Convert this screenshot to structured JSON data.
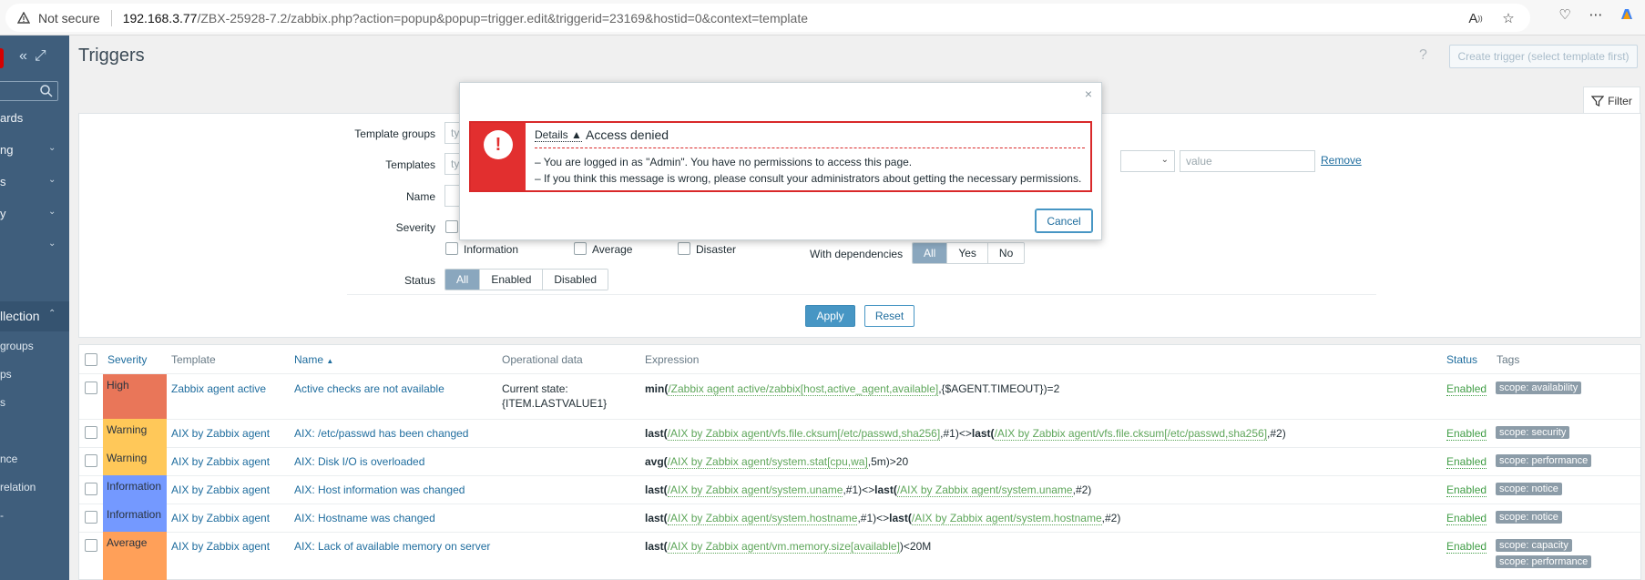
{
  "browser": {
    "not_secure": "Not secure",
    "url_host": "192.168.3.77",
    "url_rest": "/ZBX-25928-7.2/zabbix.php?action=popup&popup=trigger.edit&triggerid=23169&hostid=0&context=template"
  },
  "sidebar": {
    "items": [
      {
        "label": "ards",
        "chevron": false
      },
      {
        "label": "ng",
        "chevron": true
      },
      {
        "label": "s",
        "chevron": true
      },
      {
        "label": "y",
        "chevron": true
      },
      {
        "label": "",
        "chevron": true
      },
      {
        "label": "llection",
        "chevron": true
      },
      {
        "label": "",
        "chevron": true
      }
    ],
    "subitems": [
      "groups",
      "ps",
      "s",
      "nce",
      "relation",
      "-"
    ]
  },
  "page": {
    "title": "Triggers",
    "help": "?",
    "create_button": "Create trigger (select template first)"
  },
  "filter": {
    "tab_label": "Filter",
    "template_groups_label": "Template groups",
    "templates_label": "Templates",
    "name_label": "Name",
    "severity_label": "Severity",
    "status_label": "Status",
    "input_placeholder_short": "ty",
    "value_placeholder": "value",
    "remove": "Remove",
    "severity_options": [
      "Information",
      "Average",
      "Disaster"
    ],
    "status_options": [
      "All",
      "Enabled",
      "Disabled"
    ],
    "with_dependencies_label": "With dependencies",
    "dependency_options": [
      "All",
      "Yes",
      "No"
    ],
    "apply": "Apply",
    "reset": "Reset"
  },
  "table": {
    "headers": {
      "severity": "Severity",
      "template": "Template",
      "name": "Name",
      "name_sort": "▲",
      "operational_data": "Operational data",
      "expression": "Expression",
      "status": "Status",
      "tags": "Tags"
    },
    "rows": [
      {
        "severity": "High",
        "severity_color": "#e97659",
        "template": "Zabbix agent active",
        "name": "Active checks are not available",
        "opdata1": "Current state:",
        "opdata2": "{ITEM.LASTVALUE1}",
        "fn1": "min(",
        "key1": "/Zabbix agent active/zabbix[host,active_agent,available]",
        "mid": ",{$AGENT.TIMEOUT})=2",
        "fn2": "",
        "key2": "",
        "end": "",
        "status": "Enabled",
        "tags": [
          "scope: availability"
        ]
      },
      {
        "severity": "Warning",
        "severity_color": "#ffc859",
        "template": "AIX by Zabbix agent",
        "name": "AIX: /etc/passwd has been changed",
        "opdata1": "",
        "opdata2": "",
        "fn1": "last(",
        "key1": "/AIX by Zabbix agent/vfs.file.cksum[/etc/passwd,sha256]",
        "mid": ",#1)<>",
        "fn2": "last(",
        "key2": "/AIX by Zabbix agent/vfs.file.cksum[/etc/passwd,sha256]",
        "end": ",#2)",
        "status": "Enabled",
        "tags": [
          "scope: security"
        ]
      },
      {
        "severity": "Warning",
        "severity_color": "#ffc859",
        "template": "AIX by Zabbix agent",
        "name": "AIX: Disk I/O is overloaded",
        "opdata1": "",
        "opdata2": "",
        "fn1": "avg(",
        "key1": "/AIX by Zabbix agent/system.stat[cpu,wa]",
        "mid": ",5m)>20",
        "fn2": "",
        "key2": "",
        "end": "",
        "status": "Enabled",
        "tags": [
          "scope: performance"
        ]
      },
      {
        "severity": "Information",
        "severity_color": "#7499ff",
        "template": "AIX by Zabbix agent",
        "name": "AIX: Host information was changed",
        "opdata1": "",
        "opdata2": "",
        "fn1": "last(",
        "key1": "/AIX by Zabbix agent/system.uname",
        "mid": ",#1)<>",
        "fn2": "last(",
        "key2": "/AIX by Zabbix agent/system.uname",
        "end": ",#2)",
        "status": "Enabled",
        "tags": [
          "scope: notice"
        ]
      },
      {
        "severity": "Information",
        "severity_color": "#7499ff",
        "template": "AIX by Zabbix agent",
        "name": "AIX: Hostname was changed",
        "opdata1": "",
        "opdata2": "",
        "fn1": "last(",
        "key1": "/AIX by Zabbix agent/system.hostname",
        "mid": ",#1)<>",
        "fn2": "last(",
        "key2": "/AIX by Zabbix agent/system.hostname",
        "end": ",#2)",
        "status": "Enabled",
        "tags": [
          "scope: notice"
        ]
      },
      {
        "severity": "Average",
        "severity_color": "#ffa059",
        "template": "AIX by Zabbix agent",
        "name": "AIX: Lack of available memory on server",
        "opdata1": "",
        "opdata2": "",
        "fn1": "last(",
        "key1": "/AIX by Zabbix agent/vm.memory.size[available]",
        "mid": ")<20M",
        "fn2": "",
        "key2": "",
        "end": "",
        "status": "Enabled",
        "tags": [
          "scope: capacity",
          "scope: performance"
        ]
      }
    ]
  },
  "modal": {
    "details": "Details ▲",
    "title": "Access denied",
    "lines": [
      "– You are logged in as \"Admin\". You have no permissions to access this page.",
      "– If you think this message is wrong, please consult your administrators about getting the necessary permissions."
    ],
    "cancel": "Cancel",
    "close": "×"
  }
}
